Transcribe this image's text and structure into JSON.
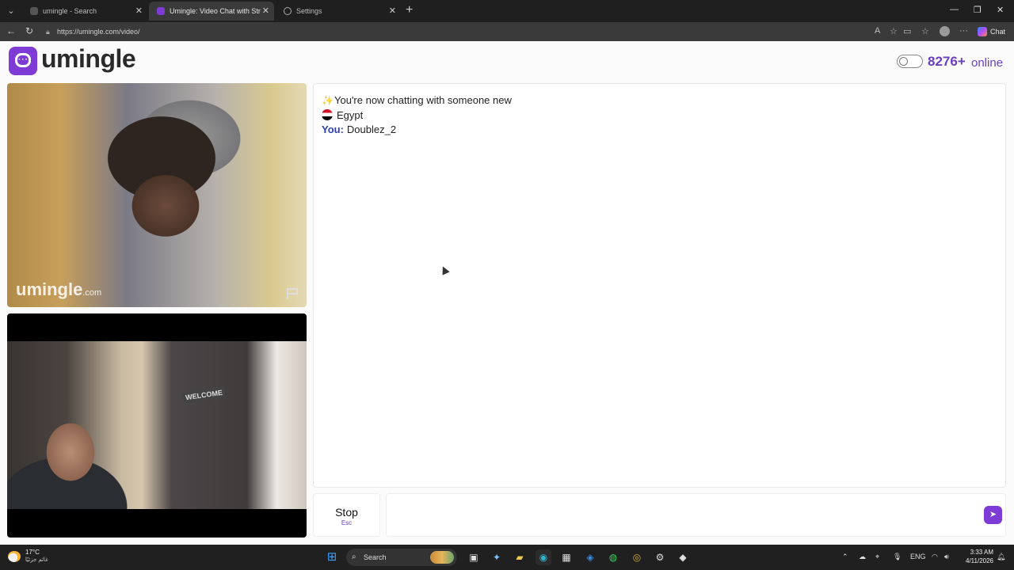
{
  "browser": {
    "tabs": [
      {
        "title": "umingle - Search",
        "active": false
      },
      {
        "title": "Umingle: Video Chat with Str",
        "active": true
      },
      {
        "title": "Settings",
        "active": false
      }
    ],
    "url": "https://umingle.com/video/",
    "copilot_label": "Chat"
  },
  "site": {
    "brand": "umingle",
    "online_count": "8276+",
    "online_label": "online"
  },
  "video": {
    "watermark": "umingle",
    "watermark_suffix": ".com",
    "welcome_sign": "WELCOME"
  },
  "chat": {
    "status_message": "You're now chatting with someone new",
    "country": "Egypt",
    "you_label": "You:",
    "you_name": "Doublez_2"
  },
  "controls": {
    "stop_label": "Stop",
    "stop_shortcut": "Esc"
  },
  "taskbar": {
    "temperature": "17°C",
    "weather_condition": "غائم جزئيًا",
    "search_label": "Search",
    "language": "ENG",
    "time": "3:33 AM",
    "date": "4/11/2026"
  },
  "colors": {
    "brand": "#7e3bd6",
    "online_text": "#6a3fc1",
    "you_label": "#2a3fbf"
  }
}
